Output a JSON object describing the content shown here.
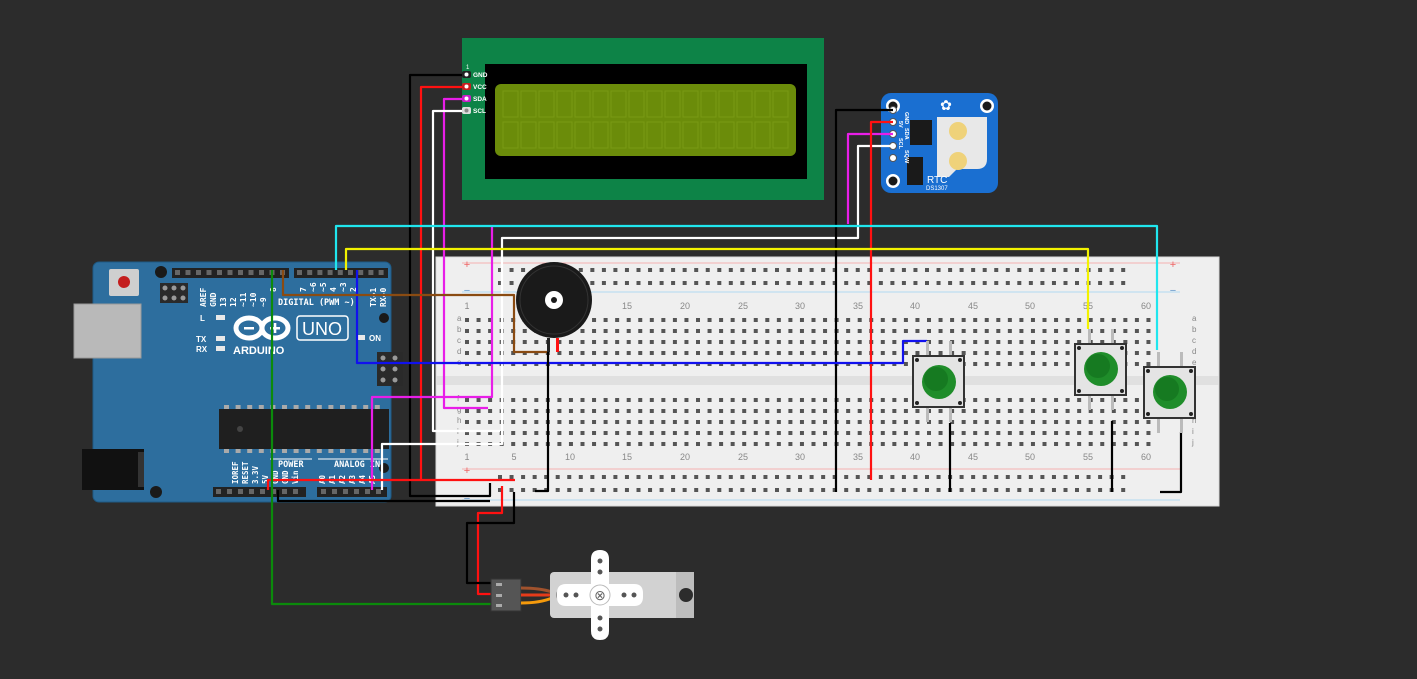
{
  "arduino": {
    "brand": "ARDUINO",
    "model": "UNO",
    "digital_label": "DIGITAL (PWM ~)",
    "power_label": "POWER",
    "analog_label": "ANALOG IN",
    "led_labels": [
      "L",
      "TX",
      "RX"
    ],
    "on_label": "ON",
    "top_pins": [
      "AREF",
      "GND",
      "13",
      "12",
      "~11",
      "~10",
      "~9",
      "8",
      "7",
      "~6",
      "~5",
      "4",
      "~3",
      "2",
      "TX→1",
      "RX←0"
    ],
    "bottom_pins": [
      "IOREF",
      "RESET",
      "3.3V",
      "5V",
      "GND",
      "GND",
      "Vin",
      "A0",
      "A1",
      "A2",
      "A3",
      "A4",
      "A5"
    ]
  },
  "lcd": {
    "pin_number": "1",
    "pins": [
      "GND",
      "VCC",
      "SDA",
      "SCL"
    ]
  },
  "rtc": {
    "title": "RTC",
    "chip": "DS1307",
    "pins": [
      "GND",
      "5V",
      "SDA",
      "SCL",
      "SQW"
    ]
  },
  "breadboard": {
    "column_numbers": [
      "1",
      "5",
      "10",
      "15",
      "20",
      "25",
      "30",
      "35",
      "40",
      "45",
      "50",
      "55",
      "60"
    ],
    "rows_top": [
      "a",
      "b",
      "c",
      "d",
      "e"
    ],
    "rows_bottom": [
      "f",
      "g",
      "h",
      "i",
      "j"
    ],
    "plus": "+",
    "minus": "−"
  },
  "colors": {
    "background": "#2c2c2c",
    "arduino_blue": "#2d6e9e",
    "lcd_green": "#0d8347",
    "lcd_screen": "#6b8c0a",
    "rtc_blue": "#1a6fd1",
    "button_green": "#1f8d2a",
    "wire_black": "#000000",
    "wire_red": "#ff1111",
    "wire_white": "#ffffff",
    "wire_magenta": "#e81ee8",
    "wire_cyan": "#20e6ee",
    "wire_yellow": "#f2f200",
    "wire_blue": "#1111ee",
    "wire_green": "#0b8a0b",
    "wire_brown": "#8a4b12"
  }
}
